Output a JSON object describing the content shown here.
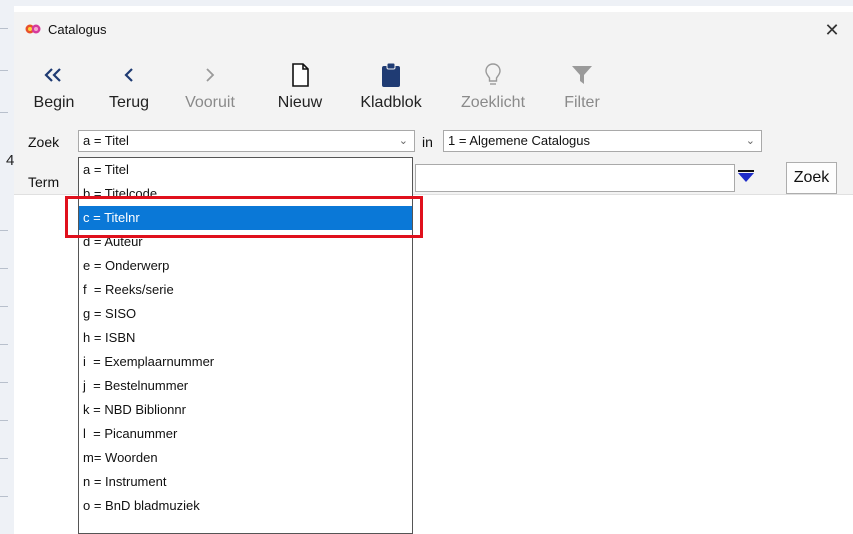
{
  "window": {
    "title": "Catalogus",
    "close_glyph": "✕"
  },
  "background": {
    "left_digit": "4"
  },
  "toolbar": {
    "items": [
      {
        "label": "Begin",
        "icon": "double-chevron-left-icon",
        "enabled": true
      },
      {
        "label": "Terug",
        "icon": "chevron-left-icon",
        "enabled": true
      },
      {
        "label": "Vooruit",
        "icon": "chevron-right-icon",
        "enabled": false
      },
      {
        "label": "Nieuw",
        "icon": "new-document-icon",
        "enabled": true
      },
      {
        "label": "Kladblok",
        "icon": "clipboard-icon",
        "enabled": true
      },
      {
        "label": "Zoeklicht",
        "icon": "lightbulb-icon",
        "enabled": false
      },
      {
        "label": "Filter",
        "icon": "filter-icon",
        "enabled": false
      }
    ]
  },
  "search": {
    "zoek_label": "Zoek",
    "zoek_value": "a = Titel",
    "in_label": "in",
    "catalog_value": "1 = Algemene Catalogus",
    "term_label": "Term",
    "term_value": "",
    "zoek_button": "Zoek"
  },
  "dropdown": {
    "selected_index": 2,
    "options": [
      "a = Titel",
      "b = Titelcode",
      "c = Titelnr",
      "d = Auteur",
      "e = Onderwerp",
      "f  = Reeks/serie",
      "g = SISO",
      "h = ISBN",
      "i  = Exemplaarnummer",
      "j  = Bestelnummer",
      "k = NBD Biblionnr",
      "l  = Picanummer",
      "m= Woorden",
      "n = Instrument",
      "o = BnD bladmuziek"
    ]
  },
  "colors": {
    "selection": "#0a78d7",
    "highlight_border": "#e0101c",
    "accent_blue": "#1e2cc8",
    "icon_navy": "#1f3b73"
  }
}
